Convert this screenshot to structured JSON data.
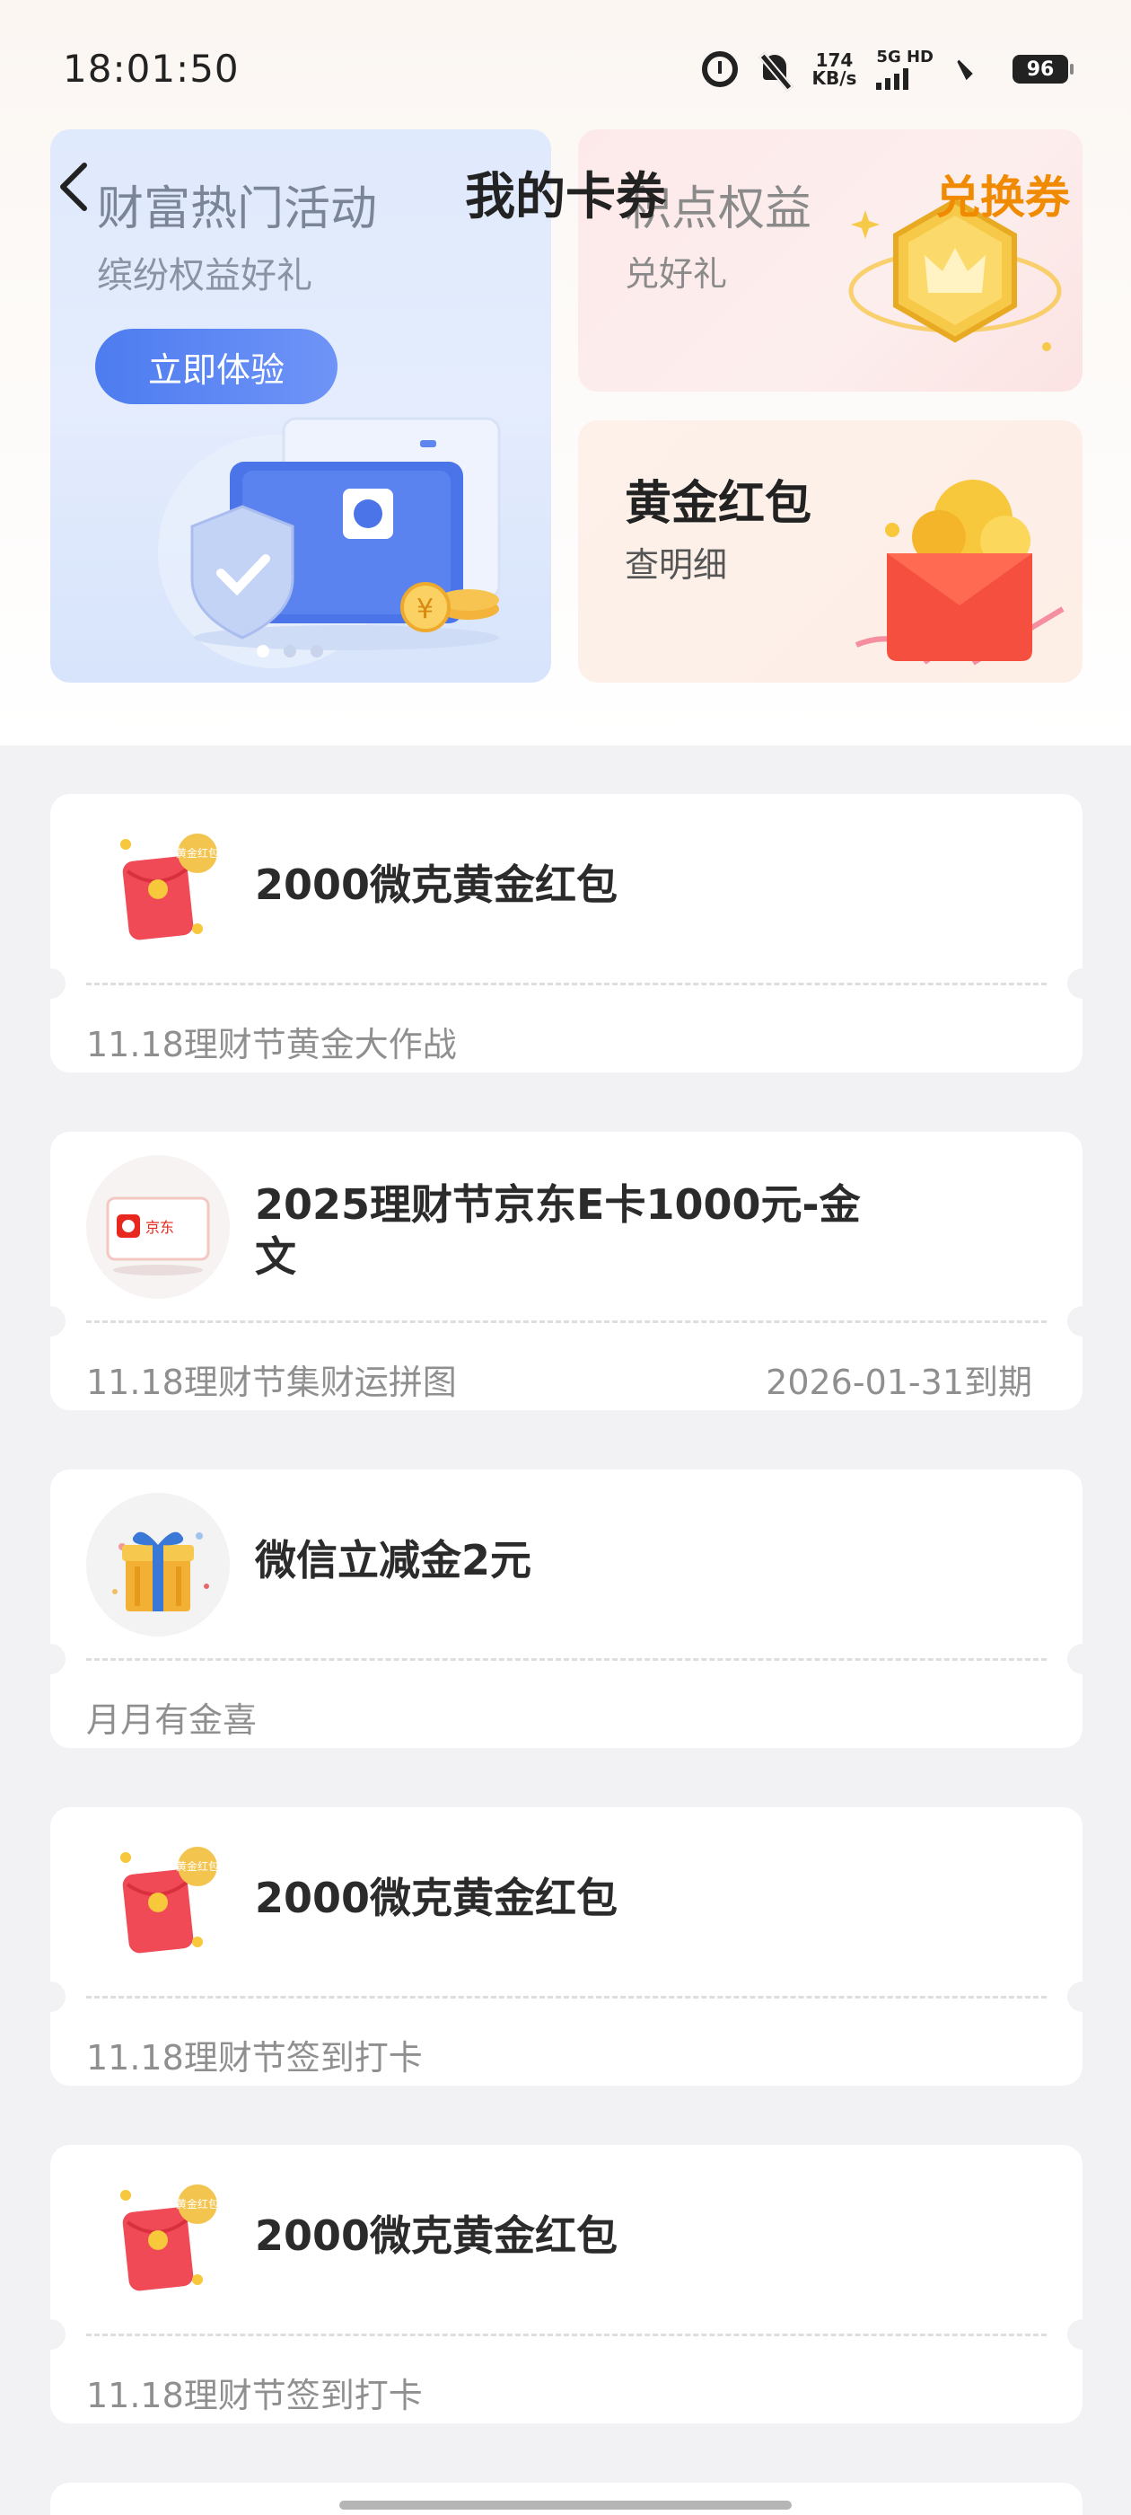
{
  "status_bar": {
    "time": "18:01:50",
    "speed_value": "174",
    "speed_unit": "KB/s",
    "network_label": "5G HD",
    "battery": "96"
  },
  "header": {
    "title": "我的卡券",
    "exchange_label": "兑换券",
    "back_icon": "chevron-left-icon"
  },
  "banners": {
    "main": {
      "title": "财富热门活动",
      "subtitle": "缤纷权益好礼",
      "button_label": "立即体验",
      "page_count": 3,
      "active_page": 1
    },
    "points": {
      "title": "积点权益",
      "subtitle": "兑好礼"
    },
    "gold_red_packet": {
      "title": "黄金红包",
      "subtitle": "查明细"
    }
  },
  "coupons": [
    {
      "icon": "red-packet-icon",
      "badge": "黄金红包",
      "title": "2000微克黄金红包",
      "source": "11.18理财节黄金大作战",
      "expiry": ""
    },
    {
      "icon": "jd-card-icon",
      "badge": "京东",
      "title": "2025理财节京东E卡1000元-金文",
      "source": "11.18理财节集财运拼图",
      "expiry": "2026-01-31到期"
    },
    {
      "icon": "gift-box-icon",
      "badge": "",
      "title": "微信立减金2元",
      "source": "月月有金喜",
      "expiry": ""
    },
    {
      "icon": "red-packet-icon",
      "badge": "黄金红包",
      "title": "2000微克黄金红包",
      "source": "11.18理财节签到打卡",
      "expiry": ""
    },
    {
      "icon": "red-packet-icon",
      "badge": "黄金红包",
      "title": "2000微克黄金红包",
      "source": "11.18理财节签到打卡",
      "expiry": ""
    }
  ],
  "colors": {
    "accent_orange": "#f08a00",
    "button_blue": "#4d7cf0",
    "background": "#f2f2f4"
  }
}
